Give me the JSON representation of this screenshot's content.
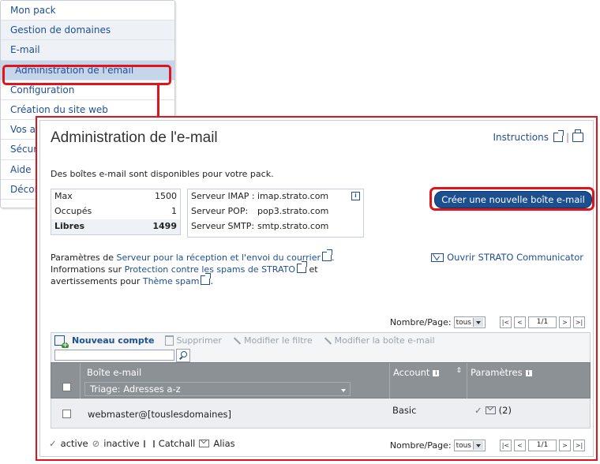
{
  "sidebar": {
    "items": [
      {
        "label": "Mon pack",
        "style": "plain"
      },
      {
        "label": "Gestion de domaines",
        "style": "grey"
      },
      {
        "label": "E-mail",
        "style": "grey"
      },
      {
        "label": "Administration de l'email",
        "style": "active"
      },
      {
        "label": "Configuration",
        "style": "plain"
      },
      {
        "label": "Création du site web",
        "style": "plain"
      },
      {
        "label": "Vos a",
        "style": "plain"
      },
      {
        "label": "Sécur",
        "style": "plain"
      },
      {
        "label": "Aide",
        "style": "plain"
      },
      {
        "label": "Décor",
        "style": "plain"
      }
    ]
  },
  "header": {
    "title": "Administration de l'e-mail",
    "instructions": "Instructions",
    "separator": "|"
  },
  "intro": "Des boîtes e-mail sont disponibles pour votre pack.",
  "stats": {
    "rows": [
      {
        "label": "Max",
        "value": "1500"
      },
      {
        "label": "Occupés",
        "value": "1"
      },
      {
        "label": "Libres",
        "value": "1499"
      }
    ]
  },
  "servers": {
    "rows": [
      {
        "label": "Serveur IMAP :",
        "value": "imap.strato.com"
      },
      {
        "label": "Serveur POP:",
        "value": "pop3.strato.com"
      },
      {
        "label": "Serveur SMTP:",
        "value": "smtp.strato.com"
      }
    ]
  },
  "create_button": "Créer une nouvelle boîte e-mail",
  "settings": {
    "line1_prefix": "Paramètres de ",
    "line1_link": "Serveur pour la réception et l'envoi du courrier",
    "line1_suffix": ".",
    "line2_prefix": "Informations sur ",
    "line2_link": "Protection contre les spams de STRATO",
    "line2_suffix": " et",
    "line3_prefix": "avertissements pour ",
    "line3_link": "Thème spam",
    "line3_suffix": "."
  },
  "communicator": "Ouvrir STRATO Communicator",
  "pager": {
    "label": "Nombre/Page:",
    "per_page": "tous",
    "first": "|<",
    "prev": "<",
    "page": "1/1",
    "next": ">",
    "last": ">|"
  },
  "toolbar": {
    "new_account": "Nouveau compte",
    "delete": "Supprimer",
    "edit_filter": "Modifier le filtre",
    "edit_mailbox": "Modifier la boîte e-mail"
  },
  "table": {
    "col_mailbox": "Boîte e-mail",
    "sort": "Triage: Adresses a-z",
    "col_account": "Account",
    "col_params": "Paramètres",
    "rows": [
      {
        "mailbox": "webmaster@[touslesdomaines]",
        "account": "Basic",
        "params_count": "(2)"
      }
    ]
  },
  "legend": {
    "active": "active",
    "inactive": "inactive",
    "catchall": "Catchall",
    "alias": "Alias"
  },
  "colors": {
    "highlight": "#e0141c",
    "link": "#1f4f94",
    "button": "#1c4f8f",
    "table_header": "#8c9196"
  }
}
